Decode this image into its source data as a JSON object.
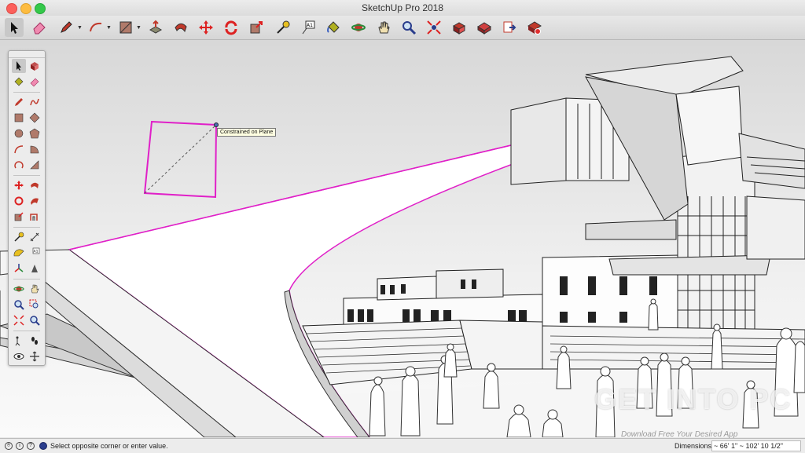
{
  "window": {
    "title": "SketchUp Pro 2018"
  },
  "toolbar": {
    "tools": [
      "select",
      "eraser",
      "pencil",
      "arc",
      "rectangle",
      "push-pull",
      "follow-me",
      "move",
      "rotate",
      "scale",
      "tape-measure",
      "text",
      "paint-bucket",
      "orbit",
      "pan",
      "zoom",
      "zoom-extents",
      "components",
      "warehouse",
      "extension-warehouse",
      "ruby"
    ]
  },
  "viewport": {
    "tooltip": "Constrained on Plane",
    "accent_color": "#e020c8"
  },
  "watermark": {
    "main": "GET INTO PC",
    "sub": "Download Free Your Desired App"
  },
  "status": {
    "message": "Select opposite corner or enter value.",
    "dimensions_label": "Dimensions",
    "dimensions_value": "~ 66' 1\" ~ 102' 10 1/2\""
  }
}
